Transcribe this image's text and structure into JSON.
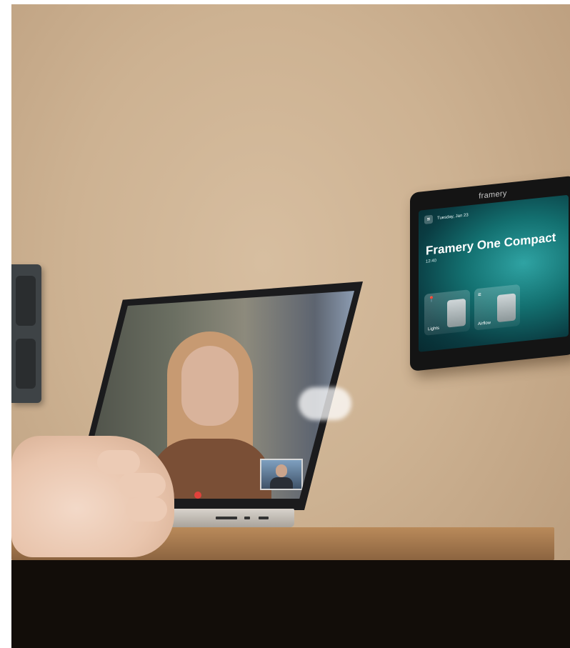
{
  "tablet": {
    "brand": "framery",
    "date": "Tuesday, Jan 23",
    "title": "Framery One Compact",
    "time": "12:40",
    "cards": [
      {
        "label": "Lights",
        "icon": "📍"
      },
      {
        "label": "Airflow",
        "icon": "≡"
      }
    ]
  },
  "colors": {
    "wall": "#d7bea0",
    "tablet_screen": "#137070",
    "table": "#b98a5a",
    "end_call": "#e2413b"
  }
}
